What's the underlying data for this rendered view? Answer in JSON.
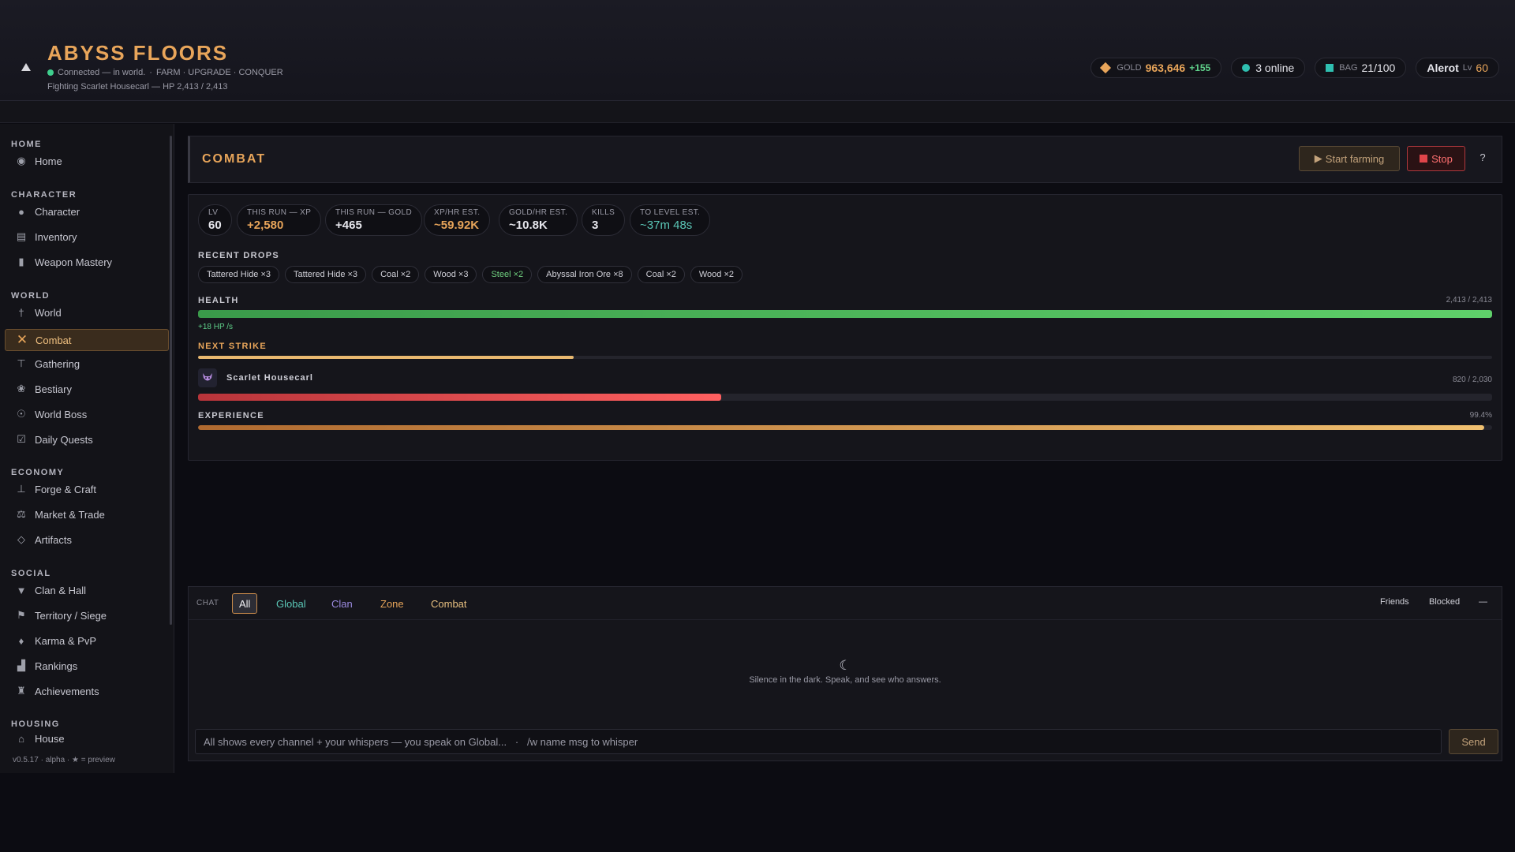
{
  "header": {
    "title": "ABYSS FLOORS",
    "connection": "Connected — in world.",
    "tagline": "FARM · UPGRADE · CONQUER",
    "fighting": "Fighting Scarlet Housecarl — HP 2,413 / 2,413",
    "gold_label": "GOLD",
    "gold_value": "963,646",
    "gold_delta": "+155",
    "online": "3 online",
    "bag_label": "BAG",
    "bag_value": "21/100",
    "player_name": "Alerot",
    "player_lv_label": "Lv",
    "player_lv": "60"
  },
  "sidebar": {
    "sections": [
      {
        "title": "HOME",
        "items": [
          {
            "label": "Home",
            "icon": "eye-icon"
          }
        ]
      },
      {
        "title": "CHARACTER",
        "items": [
          {
            "label": "Character",
            "icon": "person-icon"
          },
          {
            "label": "Inventory",
            "icon": "chest-icon"
          },
          {
            "label": "Weapon Mastery",
            "icon": "book-icon"
          }
        ]
      },
      {
        "title": "WORLD",
        "items": [
          {
            "label": "World",
            "icon": "signpost-icon"
          },
          {
            "label": "Combat",
            "icon": "crossed-swords-icon",
            "active": true
          },
          {
            "label": "Gathering",
            "icon": "pickaxe-icon"
          },
          {
            "label": "Bestiary",
            "icon": "paw-icon"
          },
          {
            "label": "World Boss",
            "icon": "demon-icon"
          },
          {
            "label": "Daily Quests",
            "icon": "checkbox-icon"
          }
        ]
      },
      {
        "title": "ECONOMY",
        "items": [
          {
            "label": "Forge & Craft",
            "icon": "anvil-icon"
          },
          {
            "label": "Market & Trade",
            "icon": "scales-icon"
          },
          {
            "label": "Artifacts",
            "icon": "gem-icon"
          }
        ]
      },
      {
        "title": "SOCIAL",
        "items": [
          {
            "label": "Clan & Hall",
            "icon": "banner-icon"
          },
          {
            "label": "Territory / Siege",
            "icon": "flag-icon"
          },
          {
            "label": "Karma & PvP",
            "icon": "drop-icon"
          },
          {
            "label": "Rankings",
            "icon": "podium-icon"
          },
          {
            "label": "Achievements",
            "icon": "trophy-icon"
          }
        ]
      },
      {
        "title": "HOUSING",
        "items": [
          {
            "label": "House",
            "icon": "house-icon"
          }
        ]
      }
    ],
    "version": "v0.5.17 · alpha · ★ = preview"
  },
  "combat": {
    "title": "COMBAT",
    "start_label": "Start farming",
    "stop_label": "Stop",
    "help_label": "?",
    "stats": [
      {
        "key": "LV",
        "value": "60",
        "style": ""
      },
      {
        "key": "THIS RUN — XP",
        "value": "+2,580",
        "style": "orange"
      },
      {
        "key": "THIS RUN — GOLD",
        "value": "+465",
        "style": ""
      },
      {
        "key": "XP/HR EST.",
        "value": "~59.92K",
        "style": "orange"
      },
      {
        "key": "GOLD/HR EST.",
        "value": "~10.8K",
        "style": ""
      },
      {
        "key": "KILLS",
        "value": "3",
        "style": ""
      },
      {
        "key": "TO LEVEL EST.",
        "value": "~37m 48s",
        "style": "cyan"
      }
    ],
    "recent_drops_label": "RECENT DROPS",
    "drops": [
      {
        "label": "Tattered Hide ×3",
        "style": ""
      },
      {
        "label": "Tattered Hide ×3",
        "style": ""
      },
      {
        "label": "Coal ×2",
        "style": ""
      },
      {
        "label": "Wood ×3",
        "style": ""
      },
      {
        "label": "Steel ×2",
        "style": "green"
      },
      {
        "label": "Abyssal Iron Ore ×8",
        "style": ""
      },
      {
        "label": "Coal ×2",
        "style": ""
      },
      {
        "label": "Wood ×2",
        "style": ""
      }
    ],
    "health_label": "HEALTH",
    "health_text": "2,413 / 2,413",
    "health_fraction": 1.0,
    "regen_text": "+18 HP /s",
    "next_strike_label": "NEXT STRIKE",
    "next_strike_fraction": 0.29,
    "enemy_name": "Scarlet Housecarl",
    "enemy_hp_text": "820 / 2,030",
    "enemy_hp_fraction": 0.404,
    "experience_label": "EXPERIENCE",
    "experience_text": "99.4%",
    "experience_fraction": 0.994
  },
  "chat": {
    "label": "CHAT",
    "tabs": [
      "All",
      "Global",
      "Clan",
      "Zone",
      "Combat"
    ],
    "friends_label": "Friends",
    "blocked_label": "Blocked",
    "minimize_label": "—",
    "empty_text": "Silence in the dark. Speak, and see who answers.",
    "input_placeholder": "All shows every channel + your whispers — you speak on Global...   ·   /w name msg to whisper",
    "send_label": "Send"
  },
  "colors": {
    "accent": "#e8a55a",
    "health": "#5fd06a",
    "enemy": "#e0454a",
    "online": "#2fbfb0"
  }
}
